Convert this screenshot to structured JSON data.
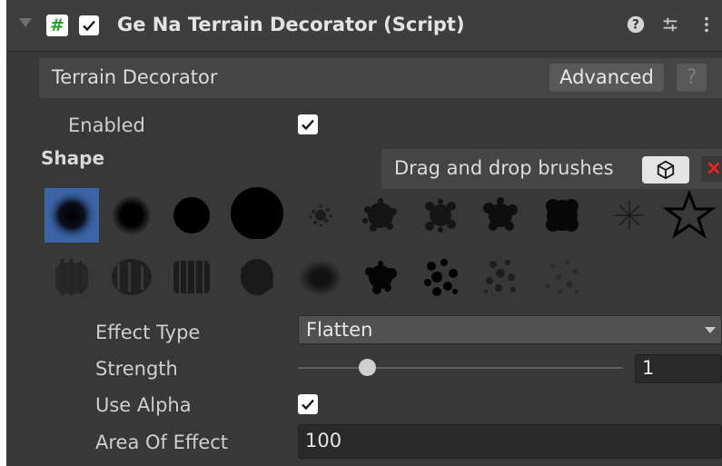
{
  "header": {
    "title": "Ge Na Terrain Decorator (Script)",
    "enabled": true,
    "icons": [
      "foldout-arrow-icon",
      "script-hash-icon",
      "help-icon",
      "presets-icon",
      "kebab-menu-icon"
    ]
  },
  "section": {
    "title": "Terrain Decorator",
    "advanced_label": "Advanced",
    "help_label": "?"
  },
  "enabled": {
    "label": "Enabled",
    "value": true
  },
  "shape": {
    "label": "Shape",
    "drag_drop_label": "Drag and drop brushes",
    "unity_button_icon": "unity-logo-icon",
    "remove_label": "×",
    "brushes_row1": [
      "soft-round",
      "blur-round",
      "medium-round",
      "hard-round",
      "spray-fine",
      "spray-dense",
      "spray-mixed",
      "splatter",
      "dense-cloud",
      "starburst",
      "star"
    ],
    "brushes_row2": [
      "grass-noise",
      "rock-noise",
      "vertical-strokes",
      "leaf-scatter",
      "smudge",
      "blob",
      "dots-large",
      "dots-scatter",
      "dots-sparse"
    ],
    "selected_index": 0
  },
  "fields": {
    "effect_type": {
      "label": "Effect Type",
      "value": "Flatten"
    },
    "strength": {
      "label": "Strength",
      "value": "1",
      "slider_fraction": 0.22
    },
    "use_alpha": {
      "label": "Use Alpha",
      "value": true
    },
    "area_of_effect": {
      "label": "Area Of Effect",
      "value": "100"
    }
  },
  "colors": {
    "panel_bg": "#383838",
    "selected_brush": "#3a64a6",
    "close_red": "#ff1e1e",
    "script_icon_green": "#1fa51f"
  }
}
